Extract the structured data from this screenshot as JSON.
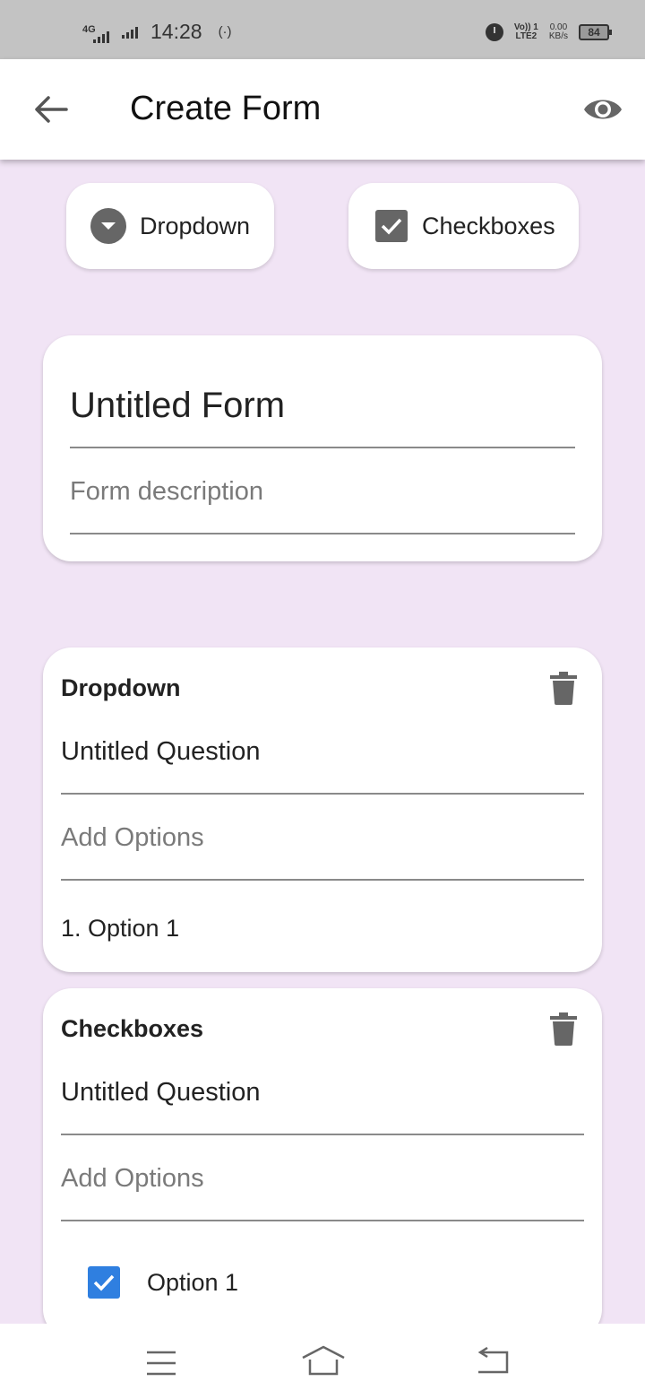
{
  "status_bar": {
    "network": "4G",
    "time": "14:28",
    "volte_line1": "Vo)) 1",
    "volte_line2": "LTE2",
    "speed_value": "0.00",
    "speed_unit": "KB/s",
    "battery": "84"
  },
  "app_bar": {
    "title": "Create Form",
    "back_icon": "arrow-back-icon",
    "preview_icon": "eye-icon"
  },
  "chips": [
    {
      "label": "Dropdown",
      "icon": "dropdown-circle-icon"
    },
    {
      "label": "Checkboxes",
      "icon": "checkbox-icon"
    }
  ],
  "form": {
    "title": "Untitled Form",
    "description_placeholder": "Form description"
  },
  "questions": [
    {
      "type": "Dropdown",
      "question": "Untitled Question",
      "options_placeholder": "Add Options",
      "options": [
        "1. Option 1"
      ]
    },
    {
      "type": "Checkboxes",
      "question": "Untitled Question",
      "options_placeholder": "Add Options",
      "options": [
        "Option 1"
      ],
      "checked": [
        true
      ]
    }
  ],
  "colors": {
    "background": "#f1e4f5",
    "checkbox_checked": "#2f7fe0",
    "icon_gray": "#666666"
  },
  "nav_bar": {
    "icons": [
      "menu-icon",
      "home-icon",
      "back-icon"
    ]
  }
}
